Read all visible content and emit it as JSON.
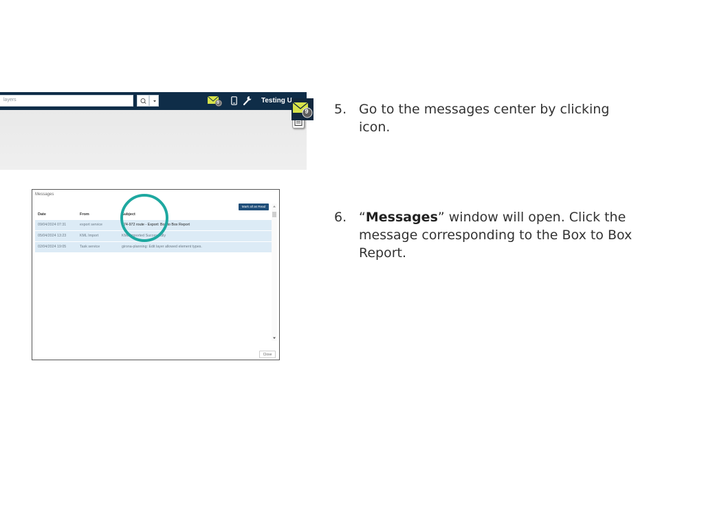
{
  "app": {
    "search_placeholder": "layers",
    "user_name": "Testing User",
    "message_badge": "9"
  },
  "messages_window": {
    "title": "Messages",
    "mark_all_read": "Mark all as Read",
    "close": "Close",
    "columns": [
      "Date",
      "From",
      "Subject"
    ],
    "rows": [
      {
        "date": "09/04/2024 07:31",
        "from": "export service",
        "subject": "974-972 route - Export: Box to Box Report"
      },
      {
        "date": "05/04/2024 13:23",
        "from": "KML Import",
        "subject": "KML Imported Successfully"
      },
      {
        "date": "02/04/2024 19:05",
        "from": "Task service",
        "subject": "girona-planning: Edit layer allowed element types."
      }
    ]
  },
  "steps": {
    "step5_number": "5.",
    "step5_text": "Go to the messages center by clicking icon.",
    "step6_number": "6.",
    "step6_quote_open": "“",
    "step6_bold": "Messages",
    "step6_rest": "” window will open. Click the message corresponding to the Box to Box Report."
  },
  "colors": {
    "topbar": "#0f2d48",
    "mail_icon": "#d7e34a",
    "highlight_circle": "#1ea8a0",
    "row_highlight": "#dcebf6",
    "button": "#1f4e79"
  }
}
